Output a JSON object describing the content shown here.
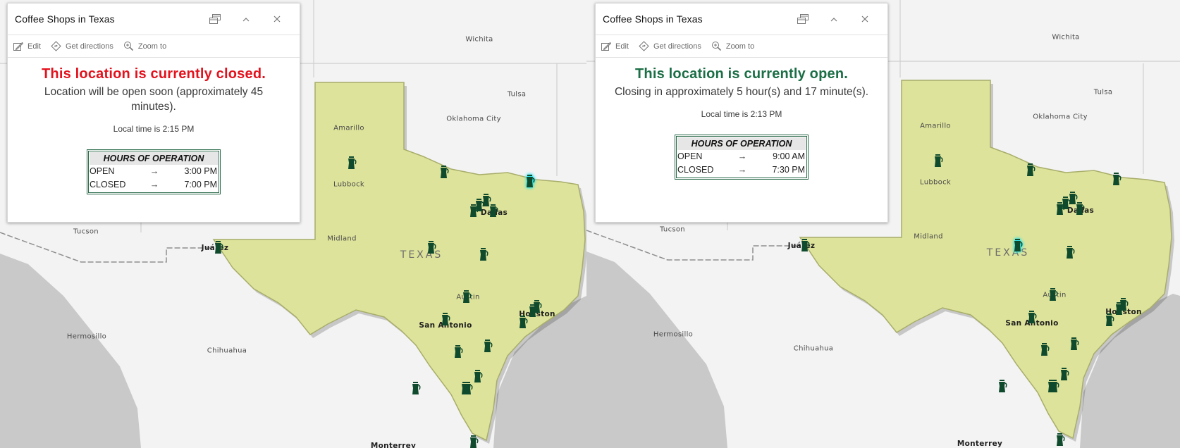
{
  "colors": {
    "closed_red": "#e3121d",
    "open_green": "#1b6e45",
    "texas_fill": "#dde39a",
    "marker_green": "#0f4a2d",
    "selected_glow": "#22e5ef",
    "hours_border": "#2a6a4a",
    "water": "#c9c9c9",
    "land": "#f3f3f3"
  },
  "panels": [
    {
      "popup": {
        "title": "Coffee Shops in Texas",
        "header_icons": [
          "dock-icon",
          "collapse-chevron-up-icon",
          "close-icon"
        ],
        "toolbar": [
          {
            "label": "Edit",
            "icon": "edit-pencil-icon"
          },
          {
            "label": "Get directions",
            "icon": "directions-diamond-icon"
          },
          {
            "label": "Zoom to",
            "icon": "zoom-to-magnifier-icon"
          }
        ],
        "status": "This location is currently closed.",
        "status_state": "closed",
        "detail": "Location will be open soon (approximately 45 minutes).",
        "local_time": "Local time is 2:15 PM",
        "hours": {
          "heading": "HOURS OF OPERATION",
          "rows": [
            {
              "label": "OPEN",
              "arrow": "→",
              "value": "3:00 PM"
            },
            {
              "label": "CLOSED",
              "arrow": "→",
              "value": "7:00 PM"
            }
          ]
        }
      },
      "selected_marker": "Paris area (northeast Texas)"
    },
    {
      "popup": {
        "title": "Coffee Shops in Texas",
        "header_icons": [
          "dock-icon",
          "collapse-chevron-up-icon",
          "close-icon"
        ],
        "toolbar": [
          {
            "label": "Edit",
            "icon": "edit-pencil-icon"
          },
          {
            "label": "Get directions",
            "icon": "directions-diamond-icon"
          },
          {
            "label": "Zoom to",
            "icon": "zoom-to-magnifier-icon"
          }
        ],
        "status": "This location is currently open.",
        "status_state": "open",
        "detail": "Closing in approximately 5 hour(s) and 17 minute(s).",
        "local_time": "Local time is 2:13 PM",
        "hours": {
          "heading": "HOURS OF OPERATION",
          "rows": [
            {
              "label": "OPEN",
              "arrow": "→",
              "value": "9:00 AM"
            },
            {
              "label": "CLOSED",
              "arrow": "→",
              "value": "7:30 PM"
            }
          ]
        }
      },
      "selected_marker": "Central Texas (near TEXAS label)"
    }
  ],
  "map": {
    "state_label": "TEXAS",
    "city_labels": [
      {
        "name": "Wichita",
        "bold": false
      },
      {
        "name": "Tulsa",
        "bold": false
      },
      {
        "name": "Oklahoma City",
        "bold": false
      },
      {
        "name": "Amarillo",
        "bold": false
      },
      {
        "name": "Lubbock",
        "bold": false
      },
      {
        "name": "Midland",
        "bold": false
      },
      {
        "name": "Tucson",
        "bold": false
      },
      {
        "name": "Juárez",
        "bold": true
      },
      {
        "name": "Dallas",
        "bold": true
      },
      {
        "name": "Austin",
        "bold": false
      },
      {
        "name": "San Antonio",
        "bold": true
      },
      {
        "name": "Houston",
        "bold": true
      },
      {
        "name": "Hermosillo",
        "bold": false
      },
      {
        "name": "Chihuahua",
        "bold": false
      },
      {
        "name": "Monterrey",
        "bold": true
      }
    ],
    "marker_icon": "coffee-pot-icon"
  }
}
